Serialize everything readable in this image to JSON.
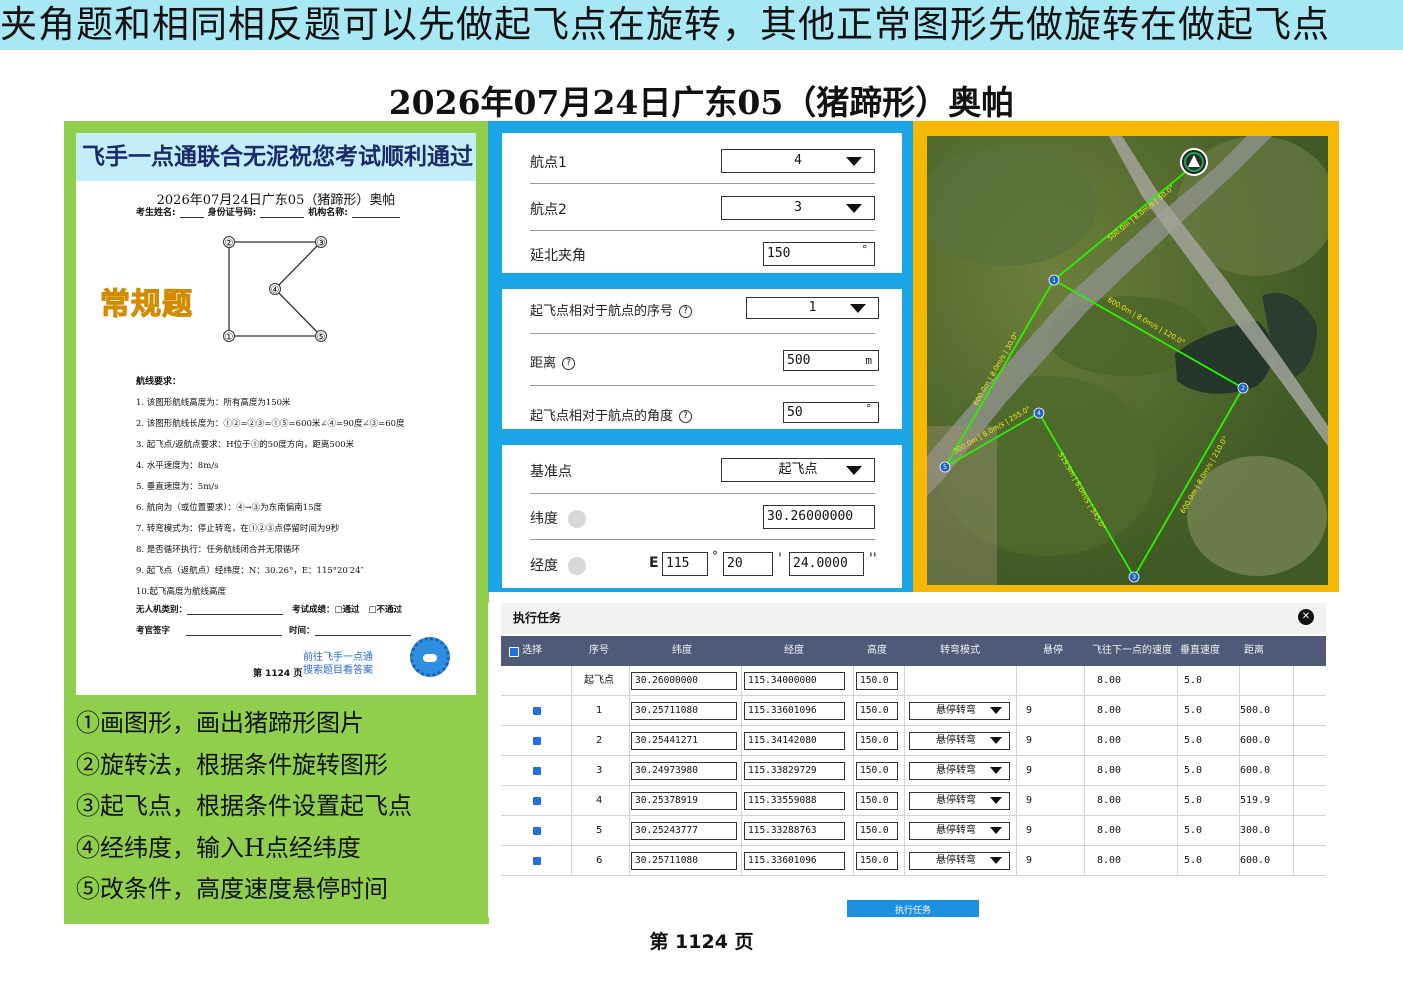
{
  "banner": "夹角题和相同相反题可以先做起飞点在旋转，其他正常图形先做旋转在做起飞点",
  "main_title": "2026年07月24日广东05（猪蹄形）奥帕",
  "paper": {
    "header": "飞手一点通联合无泥祝您考试顺利通过",
    "subtitle": "2026年07月24日广东05（猪蹄形）奥帕",
    "field_name": "考生姓名:",
    "field_id": "身份证号码:",
    "field_org": "机构名称:",
    "tag": "常规题",
    "points": [
      "①",
      "②",
      "③",
      "④",
      "⑤"
    ],
    "req_title": "航线要求：",
    "requirements": [
      "1.  该图形航线高度为：所有高度为150米",
      "2.  该图形航线长度为：①②=②③=①⑤=600米∠④=90度∠③=60度",
      "3.  起飞点/返航点要求：H位于①的50度方向，距离500米",
      "4.  水平速度为：8m/s",
      "5.  垂直速度为：5m/s",
      "6.  航向为（或位置要求）：④→③为东南偏南15度",
      "7.  转弯模式为：停止转弯，在①②③点停留时间为9秒",
      "8.  是否循环执行：任务航线闭合并无限循环",
      "9.  起飞点（返航点）经纬度：N：30.26°，E：115°20′24″",
      "10.起飞高度为航线高度"
    ],
    "uav_type": "无人机类别：",
    "result": "考试成绩：",
    "pass": "□通过",
    "fail": "□不通过",
    "signature": "考官签字",
    "time": "时间：",
    "link_line1": "前往飞手一点通",
    "link_line2": "搜索题目看答案",
    "page": "第 1124 页"
  },
  "steps": [
    "①画图形，画出猪蹄形图片",
    "②旋转法，根据条件旋转图形",
    "③起飞点，根据条件设置起飞点",
    "④经纬度，输入H点经纬度",
    "⑤改条件，高度速度悬停时间"
  ],
  "form": {
    "wp1_label": "航点1",
    "wp1_value": "4",
    "wp2_label": "航点2",
    "wp2_value": "3",
    "angle_label": "延北夹角",
    "angle_value": "150",
    "deg": "°",
    "seq_label": "起飞点相对于航点的序号",
    "seq_value": "1",
    "dist_label": "距离",
    "dist_value": "500",
    "dist_unit": "m",
    "rel_angle_label": "起飞点相对于航点的角度",
    "rel_angle_value": "50",
    "base_label": "基准点",
    "base_value": "起飞点",
    "lat_label": "纬度",
    "lat_value": "30.26000000",
    "lon_label": "经度",
    "lon_prefix": "E",
    "lon_deg": "115",
    "lon_min": "20",
    "lon_sec": "24.0000",
    "min_mark": "'",
    "sec_mark": "''",
    "help": "?"
  },
  "map": {
    "labels": [
      "1",
      "2",
      "3",
      "4",
      "5"
    ],
    "segments": [
      "500.0m | 8.0m/s | 50.0°",
      "600.0m | 8.0m/s | 120.0°",
      "600.0m | 8.0m/s | 210.0°",
      "519.9m | 8.0m/s | 345.0°",
      "300.0m | 8.0m/s | 255.0°",
      "600.0m | 8.0m/s | 30.0°"
    ]
  },
  "task": {
    "title": "执行任务",
    "close": "✕",
    "headers": [
      "选择",
      "序号",
      "纬度",
      "经度",
      "高度",
      "转弯模式",
      "悬停",
      "飞往下一点的速度",
      "垂直速度",
      "距离"
    ],
    "rows": [
      {
        "seq": "起飞点",
        "lat": "30.26000000",
        "lon": "115.34000000",
        "alt": "150.0",
        "mode": "",
        "hover": "",
        "speed": "8.00",
        "vspeed": "5.0",
        "dist": ""
      },
      {
        "seq": "1",
        "lat": "30.25711080",
        "lon": "115.33601096",
        "alt": "150.0",
        "mode": "悬停转弯",
        "hover": "9",
        "speed": "8.00",
        "vspeed": "5.0",
        "dist": "500.0"
      },
      {
        "seq": "2",
        "lat": "30.25441271",
        "lon": "115.34142080",
        "alt": "150.0",
        "mode": "悬停转弯",
        "hover": "9",
        "speed": "8.00",
        "vspeed": "5.0",
        "dist": "600.0"
      },
      {
        "seq": "3",
        "lat": "30.24973980",
        "lon": "115.33829729",
        "alt": "150.0",
        "mode": "悬停转弯",
        "hover": "9",
        "speed": "8.00",
        "vspeed": "5.0",
        "dist": "600.0"
      },
      {
        "seq": "4",
        "lat": "30.25378919",
        "lon": "115.33559088",
        "alt": "150.0",
        "mode": "悬停转弯",
        "hover": "9",
        "speed": "8.00",
        "vspeed": "5.0",
        "dist": "519.9"
      },
      {
        "seq": "5",
        "lat": "30.25243777",
        "lon": "115.33288763",
        "alt": "150.0",
        "mode": "悬停转弯",
        "hover": "9",
        "speed": "8.00",
        "vspeed": "5.0",
        "dist": "300.0"
      },
      {
        "seq": "6",
        "lat": "30.25711080",
        "lon": "115.33601096",
        "alt": "150.0",
        "mode": "悬停转弯",
        "hover": "9",
        "speed": "8.00",
        "vspeed": "5.0",
        "dist": "600.0"
      }
    ],
    "exec_button": "执行任务"
  },
  "page_number": "第 1124 页",
  "colors": {
    "banner": "#a8e8f4",
    "left": "#8fcf4c",
    "middle": "#1aa6e6",
    "map_frame": "#f7b800",
    "route": "#22e000",
    "table_head": "#4f5a78"
  }
}
